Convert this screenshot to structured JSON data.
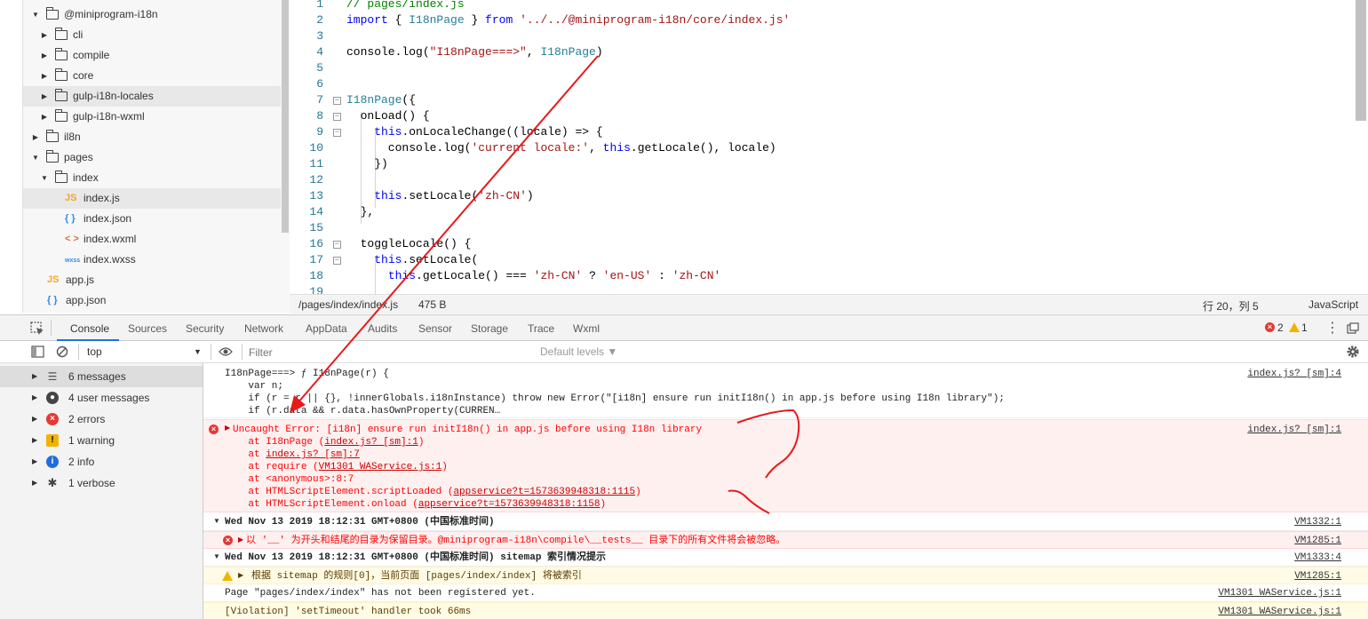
{
  "file_tree": {
    "items": [
      {
        "label": "@miniprogram-i18n",
        "kind": "folder",
        "expanded": true,
        "depth": 0
      },
      {
        "label": "cli",
        "kind": "folder",
        "expanded": false,
        "depth": 1
      },
      {
        "label": "compile",
        "kind": "folder",
        "expanded": false,
        "depth": 1
      },
      {
        "label": "core",
        "kind": "folder",
        "expanded": false,
        "depth": 1
      },
      {
        "label": "gulp-i18n-locales",
        "kind": "folder",
        "expanded": false,
        "depth": 1,
        "highlight": true
      },
      {
        "label": "gulp-i18n-wxml",
        "kind": "folder",
        "expanded": false,
        "depth": 1
      },
      {
        "label": "il8n",
        "kind": "folder",
        "expanded": false,
        "depth": 0
      },
      {
        "label": "pages",
        "kind": "folder",
        "expanded": true,
        "depth": 0
      },
      {
        "label": "index",
        "kind": "folder",
        "expanded": true,
        "depth": 1
      },
      {
        "label": "index.js",
        "kind": "js",
        "icon_text": "JS",
        "depth": 2,
        "selected": true
      },
      {
        "label": "index.json",
        "kind": "json",
        "icon_text": "{ }",
        "depth": 2
      },
      {
        "label": "index.wxml",
        "kind": "wxml",
        "icon_text": "< >",
        "depth": 2
      },
      {
        "label": "index.wxss",
        "kind": "wxss",
        "icon_text": "wxss",
        "depth": 2
      },
      {
        "label": "app.js",
        "kind": "js",
        "icon_text": "JS",
        "depth": 0
      },
      {
        "label": "app.json",
        "kind": "json",
        "icon_text": "{ }",
        "depth": 0
      }
    ]
  },
  "editor": {
    "lines": [
      {
        "n": "1",
        "fold": false,
        "tokens": [
          [
            "c",
            "// pages/index.js"
          ]
        ]
      },
      {
        "n": "2",
        "fold": false,
        "tokens": [
          [
            "k",
            "import"
          ],
          [
            "p",
            " { "
          ],
          [
            "t",
            "I18nPage"
          ],
          [
            "p",
            " } "
          ],
          [
            "k",
            "from"
          ],
          [
            "p",
            " "
          ],
          [
            "s",
            "'../../@miniprogram-i18n/core/index.js'"
          ]
        ]
      },
      {
        "n": "3",
        "fold": false,
        "tokens": []
      },
      {
        "n": "4",
        "fold": false,
        "tokens": [
          [
            "p",
            "console.log("
          ],
          [
            "s",
            "\"I18nPage===>\""
          ],
          [
            "p",
            ", "
          ],
          [
            "t",
            "I18nPage"
          ],
          [
            "p",
            ")"
          ]
        ]
      },
      {
        "n": "5",
        "fold": false,
        "tokens": []
      },
      {
        "n": "6",
        "fold": false,
        "tokens": []
      },
      {
        "n": "7",
        "fold": true,
        "tokens": [
          [
            "t",
            "I18nPage"
          ],
          [
            "p",
            "({"
          ]
        ]
      },
      {
        "n": "8",
        "fold": true,
        "tokens": [
          [
            "p",
            "  onLoad() {"
          ]
        ]
      },
      {
        "n": "9",
        "fold": true,
        "tokens": [
          [
            "p",
            "    "
          ],
          [
            "k",
            "this"
          ],
          [
            "p",
            ".onLocaleChange((locale) => {"
          ]
        ]
      },
      {
        "n": "10",
        "fold": false,
        "tokens": [
          [
            "p",
            "      console.log("
          ],
          [
            "s",
            "'current locale:'"
          ],
          [
            "p",
            ", "
          ],
          [
            "k",
            "this"
          ],
          [
            "p",
            ".getLocale(), locale)"
          ]
        ]
      },
      {
        "n": "11",
        "fold": false,
        "tokens": [
          [
            "p",
            "    })"
          ]
        ]
      },
      {
        "n": "12",
        "fold": false,
        "tokens": []
      },
      {
        "n": "13",
        "fold": false,
        "tokens": [
          [
            "p",
            "    "
          ],
          [
            "k",
            "this"
          ],
          [
            "p",
            ".setLocale("
          ],
          [
            "s",
            "'zh-CN'"
          ],
          [
            "p",
            ")"
          ]
        ]
      },
      {
        "n": "14",
        "fold": false,
        "tokens": [
          [
            "p",
            "  },"
          ]
        ]
      },
      {
        "n": "15",
        "fold": false,
        "tokens": []
      },
      {
        "n": "16",
        "fold": true,
        "tokens": [
          [
            "p",
            "  toggleLocale() {"
          ]
        ]
      },
      {
        "n": "17",
        "fold": true,
        "tokens": [
          [
            "p",
            "    "
          ],
          [
            "k",
            "this"
          ],
          [
            "p",
            ".setLocale("
          ]
        ]
      },
      {
        "n": "18",
        "fold": false,
        "tokens": [
          [
            "p",
            "      "
          ],
          [
            "k",
            "this"
          ],
          [
            "p",
            ".getLocale() === "
          ],
          [
            "s",
            "'zh-CN'"
          ],
          [
            "p",
            " ? "
          ],
          [
            "s",
            "'en-US'"
          ],
          [
            "p",
            " : "
          ],
          [
            "s",
            "'zh-CN'"
          ]
        ]
      },
      {
        "n": "19",
        "fold": false,
        "tokens": []
      }
    ]
  },
  "status_bar": {
    "path": "/pages/index/index.js",
    "size": "475 B",
    "cursor": "行 20，列 5",
    "language": "JavaScript"
  },
  "devtools_tabs": [
    "Console",
    "Sources",
    "Security",
    "Network",
    "AppData",
    "Audits",
    "Sensor",
    "Storage",
    "Trace",
    "Wxml"
  ],
  "devtools_counts": {
    "errors": "2",
    "warnings": "1"
  },
  "console_toolbar": {
    "context": "top",
    "filter_placeholder": "Filter",
    "levels": "Default levels ▼"
  },
  "console_sidebar": [
    {
      "label": "6 messages",
      "icon": "list-icon",
      "color": "#555555"
    },
    {
      "label": "4 user messages",
      "icon": "user-icon",
      "color": "#444444"
    },
    {
      "label": "2 errors",
      "icon": "error-icon",
      "color": "#e53935"
    },
    {
      "label": "1 warning",
      "icon": "warning-icon",
      "color": "#f0b400"
    },
    {
      "label": "2 info",
      "icon": "info-icon",
      "color": "#1e6fd9"
    },
    {
      "label": "1 verbose",
      "icon": "bug-icon",
      "color": "#444444"
    }
  ],
  "console_messages": {
    "log1": {
      "lines": [
        "I18nPage===> ƒ I18nPage(r) {",
        "    var n;",
        "    if (r = r || {}, !innerGlobals.i18nInstance) throw new Error(\"[i18n] ensure run initI18n() in app.js before using I18n library\");",
        "    if (r.data && r.data.hasOwnProperty(CURREN…"
      ],
      "source": "index.js? [sm]:4"
    },
    "error1": {
      "head": "Uncaught Error: [i18n] ensure run initI18n() in app.js before using I18n library",
      "source": "index.js? [sm]:1",
      "stack": [
        {
          "pre": "    at I18nPage (",
          "link": "index.js? [sm]:1",
          "post": ")"
        },
        {
          "pre": "    at ",
          "link": "index.js? [sm]:7",
          "post": ""
        },
        {
          "pre": "    at require (",
          "link": "VM1301 WAService.js:1",
          "post": ")"
        },
        {
          "pre": "    at <anonymous>:8:7",
          "link": "",
          "post": ""
        },
        {
          "pre": "    at HTMLScriptElement.scriptLoaded (",
          "link": "appservice?t=1573639948318:1115",
          "post": ")"
        },
        {
          "pre": "    at HTMLScriptElement.onload (",
          "link": "appservice?t=1573639948318:1158",
          "post": ")"
        }
      ]
    },
    "group1": {
      "text": "Wed Nov 13 2019 18:12:31 GMT+0800 (中国标准时间)",
      "source": "VM1332:1"
    },
    "error2": {
      "text": "以 '__' 为开头和结尾的目录为保留目录。@miniprogram-i18n\\compile\\__tests__ 目录下的所有文件将会被忽略。",
      "source": "VM1285:1"
    },
    "group2": {
      "text": "Wed Nov 13 2019 18:12:31 GMT+0800 (中国标准时间) sitemap 索引情况提示",
      "source": "VM1333:4"
    },
    "warn1": {
      "text": "根据 sitemap 的规则[0]，当前页面 [pages/index/index] 将被索引",
      "source": "VM1285:1"
    },
    "log2": {
      "text": "Page \"pages/index/index\" has not been registered yet.",
      "source": "VM1301 WAService.js:1"
    },
    "log3": {
      "text": "[Violation] 'setTimeout' handler took 66ms",
      "source": "VM1301 WAService.js:1"
    }
  },
  "colors": {
    "accent": "#1a73e8",
    "error_bg": "#fff0f0",
    "warning_bg": "#fffbe5",
    "annotation": "#e8191c"
  }
}
